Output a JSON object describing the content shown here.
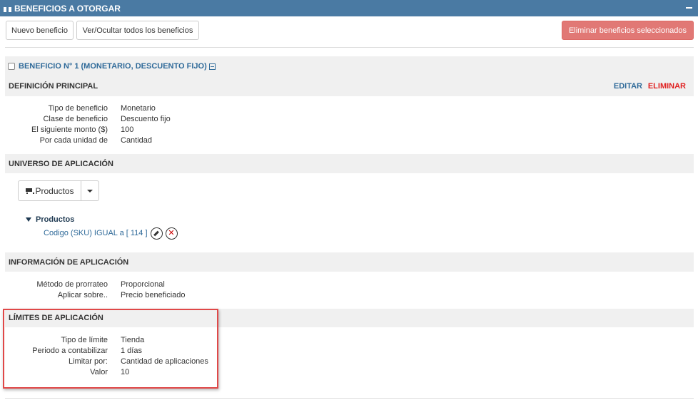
{
  "header": {
    "title": "BENEFICIOS A OTORGAR"
  },
  "toolbar": {
    "new_label": "Nuevo beneficio",
    "toggle_label": "Ver/Ocultar todos los beneficios",
    "delete_selected_label": "Eliminar beneficios seleccionados"
  },
  "benefit": {
    "title": "BENEFICIO N° 1 (MONETARIO, DESCUENTO FIJO)",
    "main_definition": {
      "heading": "DEFINICIÓN PRINCIPAL",
      "edit_label": "EDITAR",
      "delete_label": "ELIMINAR",
      "rows": [
        {
          "label": "Tipo de beneficio",
          "value": "Monetario"
        },
        {
          "label": "Clase de beneficio",
          "value": "Descuento fijo"
        },
        {
          "label": "El siguiente monto ($)",
          "value": "100"
        },
        {
          "label": "Por cada unidad de",
          "value": "Cantidad"
        }
      ]
    },
    "universe": {
      "heading": "UNIVERSO DE APLICACIÓN",
      "dropdown_label": "Productos",
      "tree_heading": "Productos",
      "tree_item": "Codigo (SKU) IGUAL a [ 114 ]"
    },
    "application_info": {
      "heading": "INFORMACIÓN DE APLICACIÓN",
      "rows": [
        {
          "label": "Método de prorrateo",
          "value": "Proporcional"
        },
        {
          "label": "Aplicar sobre..",
          "value": "Precio beneficiado"
        }
      ]
    },
    "limits": {
      "heading": "LÍMITES DE APLICACIÓN",
      "rows": [
        {
          "label": "Tipo de límite",
          "value": "Tienda"
        },
        {
          "label": "Periodo a contabilizar",
          "value": "1 días"
        },
        {
          "label": "Limitar por:",
          "value": "Cantidad de aplicaciones"
        },
        {
          "label": "Valor",
          "value": "10"
        }
      ]
    }
  },
  "colors": {
    "header_bg": "#4a7aa3",
    "link_blue": "#2f6a99",
    "danger": "#d9534f",
    "highlight_frame": "#e04848"
  }
}
